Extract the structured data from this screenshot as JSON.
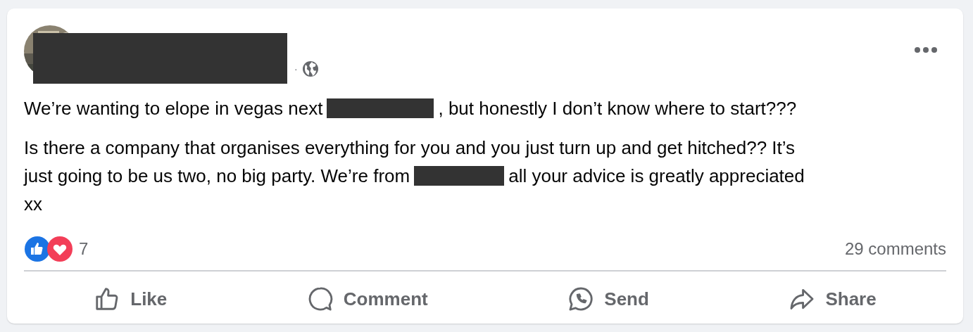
{
  "post": {
    "author_redacted": true,
    "separator": "·",
    "paragraphs": [
      [
        [
          {
            "kind": "text",
            "text": "We’re wanting to elope in vegas next"
          },
          {
            "kind": "redaction"
          },
          {
            "kind": "text",
            "text": ", but honestly I don’t know where to start???"
          }
        ]
      ],
      [
        [
          {
            "kind": "text",
            "text": "Is there a company that organises everything for you and you just turn up and get hitched?? It’s"
          }
        ],
        [
          {
            "kind": "text",
            "text": "just going to be us two, no big party. We’re from"
          },
          {
            "kind": "redaction"
          },
          {
            "kind": "text",
            "text": "all your advice is greatly appreciated"
          }
        ],
        [
          {
            "kind": "text",
            "text": "xx"
          }
        ]
      ]
    ],
    "reaction_count": "7",
    "comments": "29 comments",
    "actions": [
      {
        "kind": "like",
        "label": "Like"
      },
      {
        "kind": "comment",
        "label": "Comment"
      },
      {
        "kind": "send",
        "label": "Send"
      },
      {
        "kind": "share",
        "label": "Share"
      }
    ]
  }
}
